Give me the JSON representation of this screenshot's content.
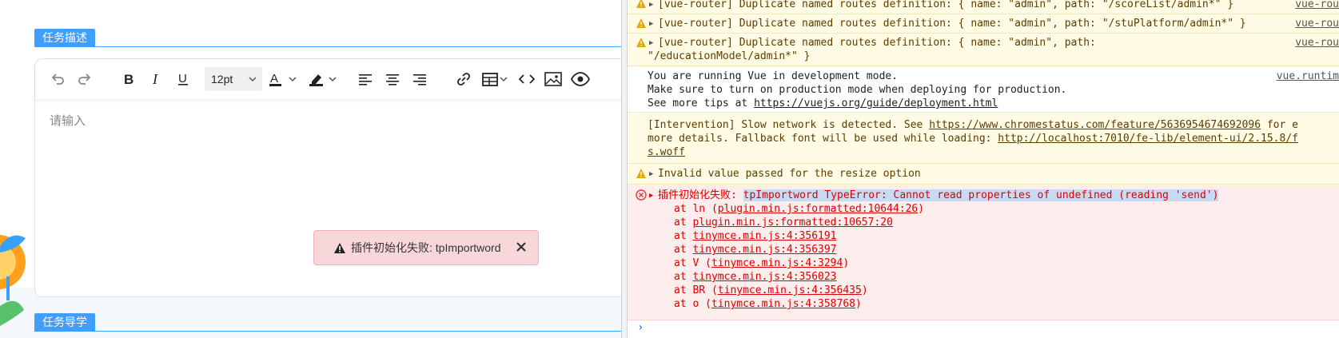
{
  "left_pane": {
    "section1_title": "任务描述",
    "section2_title": "任务导学",
    "editor": {
      "font_size": "12pt",
      "placeholder": "请输入"
    },
    "toast": {
      "message": "插件初始化失败: tpImportword",
      "close_glyph": "✕"
    }
  },
  "console": {
    "warnings": [
      {
        "message": "[vue-router] Duplicate named routes definition: { name: \"admin\", path: \"/scoreList/admin*\" }",
        "source": "vue-rou"
      },
      {
        "message": "[vue-router] Duplicate named routes definition: { name: \"admin\", path: \"/stuPlatform/admin*\" }",
        "source": "vue-rou"
      },
      {
        "message": "[vue-router] Duplicate named routes definition: { name: \"admin\", path:",
        "message_line2": "\"/educationModel/admin*\" }",
        "source": "vue-rou"
      }
    ],
    "info": {
      "line1": "You are running Vue in development mode.",
      "line2": "Make sure to turn on production mode when deploying for production.",
      "line3_prefix": "See more tips at ",
      "line3_link": "https://vuejs.org/guide/deployment.html",
      "source": "vue.runtim"
    },
    "intervention": {
      "line1_prefix": "[Intervention] Slow network is detected. See ",
      "line1_link": "https://www.chromestatus.com/feature/5636954674692096",
      "line1_suffix": " for e",
      "line2_prefix": "more details. Fallback font will be used while loading: ",
      "line2_link": "http://localhost:7010/fe-lib/element-ui/2.15.8/f",
      "line3_link": "s.woff"
    },
    "resize_warning": "Invalid value passed for the resize option",
    "error": {
      "prefix": "插件初始化失败: ",
      "highlighted": "tpImportword TypeError: Cannot read properties of undefined (reading 'send')",
      "stack": [
        {
          "at": "at ln (",
          "link": "plugin.min.js:formatted:10644:26",
          "end": ")"
        },
        {
          "at": "at ",
          "link": "plugin.min.js:formatted:10657:20",
          "end": ""
        },
        {
          "at": "at ",
          "link": "tinymce.min.js:4:356191",
          "end": ""
        },
        {
          "at": "at ",
          "link": "tinymce.min.js:4:356397",
          "end": ""
        },
        {
          "at": "at V (",
          "link": "tinymce.min.js:4:3294",
          "end": ")"
        },
        {
          "at": "at ",
          "link": "tinymce.min.js:4:356023",
          "end": ""
        },
        {
          "at": "at BR (",
          "link": "tinymce.min.js:4:356435",
          "end": ")"
        },
        {
          "at": "at o (",
          "link": "tinymce.min.js:4:358768",
          "end": ")"
        }
      ]
    },
    "prompt": "›"
  },
  "colors": {
    "accent": "#409eff",
    "error_text": "#dd0000",
    "warn_bg": "#fffbe5",
    "error_bg": "#fdeded",
    "toast_bg": "#f8d7da"
  }
}
